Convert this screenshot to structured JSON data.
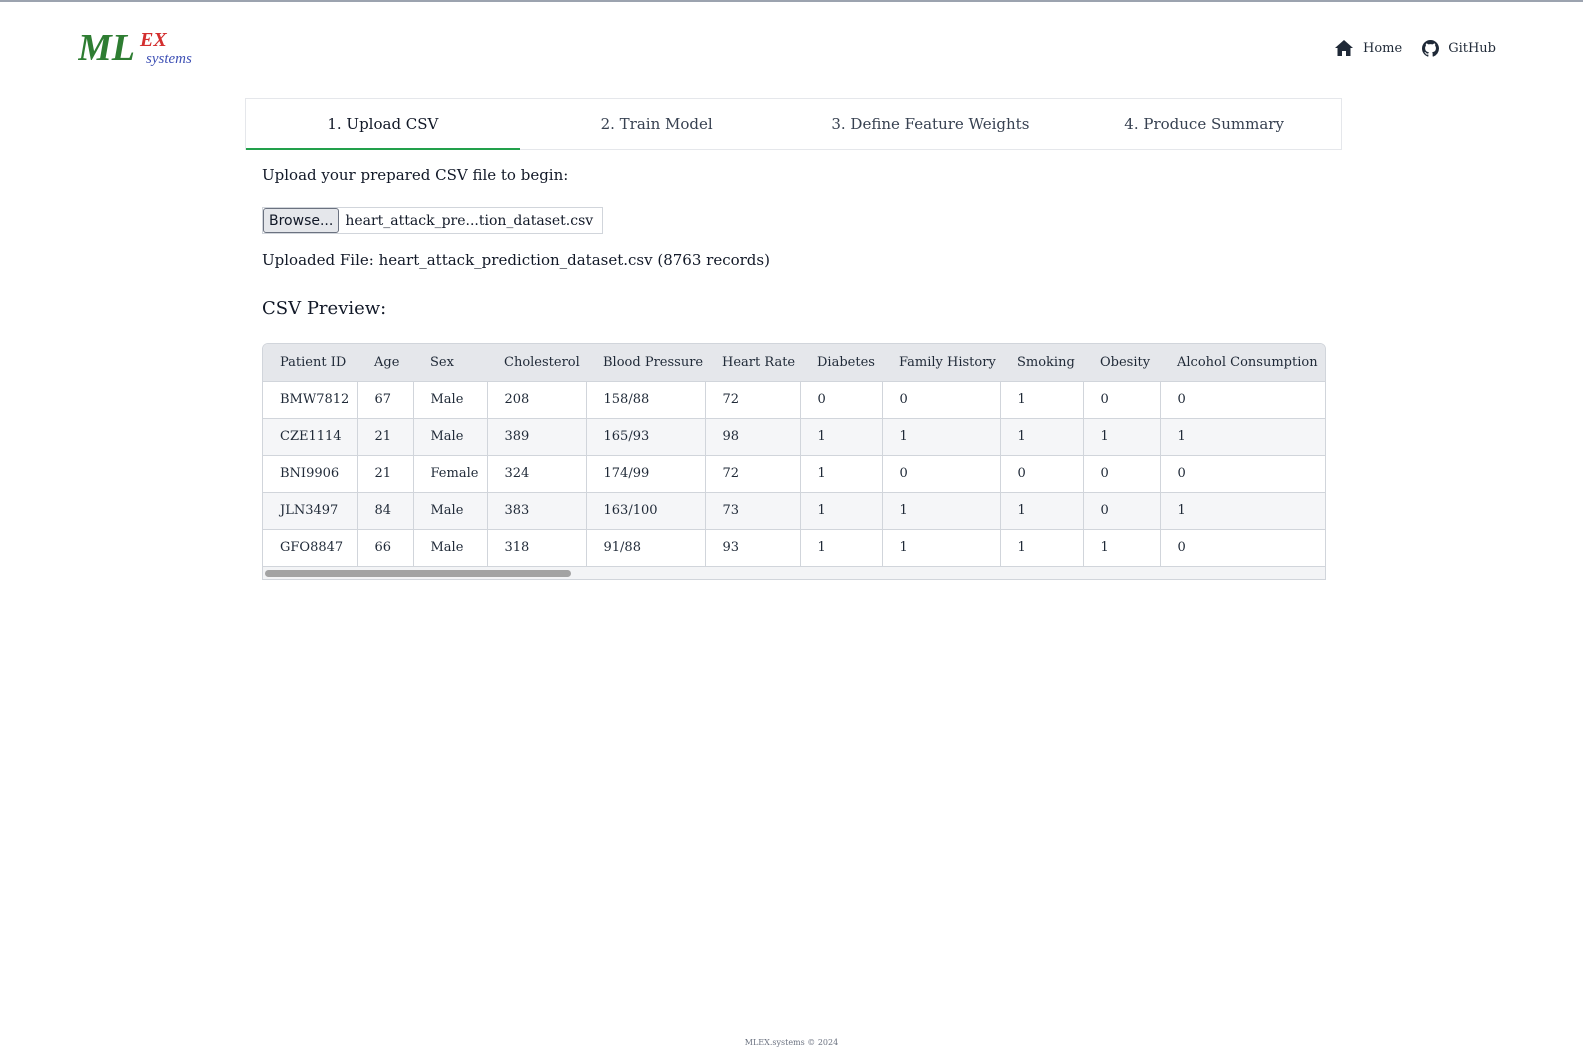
{
  "header": {
    "logo": {
      "main_text": "ML",
      "accent_text": "EX",
      "sub_text": "systems"
    },
    "nav": [
      {
        "label": "Home",
        "icon": "home-icon"
      },
      {
        "label": "GitHub",
        "icon": "github-icon"
      }
    ]
  },
  "tabs": [
    {
      "label": "1. Upload CSV",
      "active": true
    },
    {
      "label": "2. Train Model",
      "active": false
    },
    {
      "label": "3. Define Feature Weights",
      "active": false
    },
    {
      "label": "4. Produce Summary",
      "active": false
    }
  ],
  "upload": {
    "prompt": "Upload your prepared CSV file to begin:",
    "browse_label": "Browse...",
    "file_name": "heart_attack_pre...tion_dataset.csv",
    "uploaded_text": "Uploaded File: heart_attack_prediction_dataset.csv (8763 records)"
  },
  "preview": {
    "title": "CSV Preview:",
    "columns": [
      "Patient ID",
      "Age",
      "Sex",
      "Cholesterol",
      "Blood Pressure",
      "Heart Rate",
      "Diabetes",
      "Family History",
      "Smoking",
      "Obesity",
      "Alcohol Consumption"
    ],
    "rows": [
      [
        "BMW7812",
        "67",
        "Male",
        "208",
        "158/88",
        "72",
        "0",
        "0",
        "1",
        "0",
        "0"
      ],
      [
        "CZE1114",
        "21",
        "Male",
        "389",
        "165/93",
        "98",
        "1",
        "1",
        "1",
        "1",
        "1"
      ],
      [
        "BNI9906",
        "21",
        "Female",
        "324",
        "174/99",
        "72",
        "1",
        "0",
        "0",
        "0",
        "0"
      ],
      [
        "JLN3497",
        "84",
        "Male",
        "383",
        "163/100",
        "73",
        "1",
        "1",
        "1",
        "0",
        "1"
      ],
      [
        "GFO8847",
        "66",
        "Male",
        "318",
        "91/88",
        "93",
        "1",
        "1",
        "1",
        "1",
        "0"
      ]
    ]
  },
  "footer": {
    "text": "MLEX.systems © 2024"
  },
  "colors": {
    "accent": "#22a04b",
    "logo_green": "#2e7d32",
    "logo_red": "#d32f2f",
    "logo_blue": "#3f51b5"
  }
}
